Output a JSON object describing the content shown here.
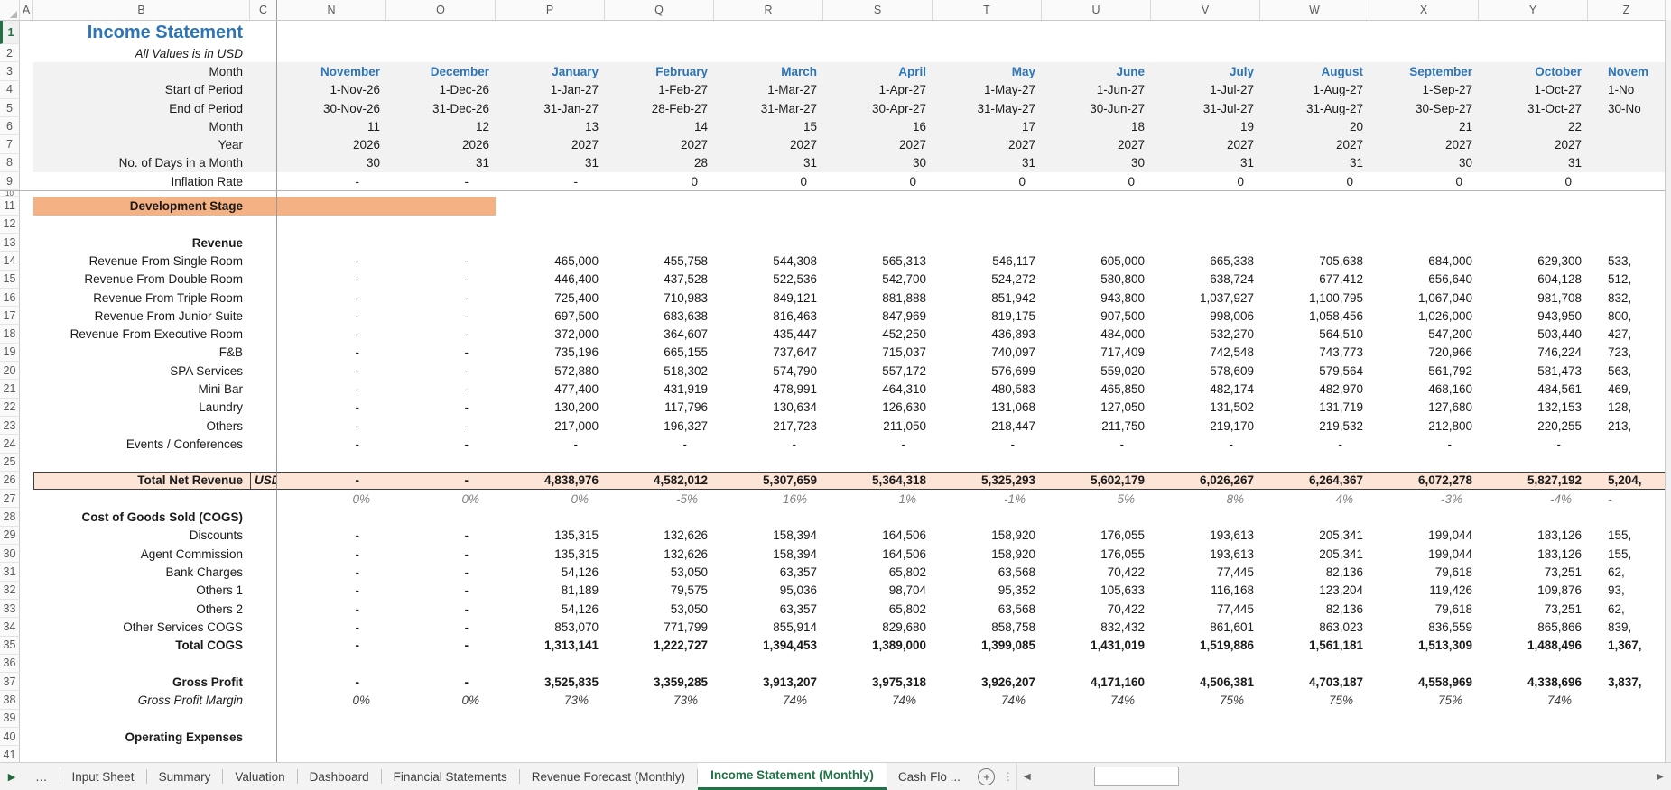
{
  "sheet": {
    "title": "Income Statement",
    "subtitle": "All Values is in USD",
    "columns": [
      "A",
      "B",
      "C",
      "N",
      "O",
      "P",
      "Q",
      "R",
      "S",
      "T",
      "U",
      "V",
      "W",
      "X",
      "Y",
      "Z"
    ],
    "rows": [
      {
        "n": 1,
        "type": "title",
        "label": "Income Statement"
      },
      {
        "n": 2,
        "type": "subtitle",
        "label": "All Values is in USD"
      },
      {
        "n": 3,
        "type": "months",
        "label": "Month",
        "v": [
          "November",
          "December",
          "January",
          "February",
          "March",
          "April",
          "May",
          "June",
          "July",
          "August",
          "September",
          "October",
          "Novem"
        ]
      },
      {
        "n": 4,
        "type": "shaded",
        "label": "Start of Period",
        "v": [
          "1-Nov-26",
          "1-Dec-26",
          "1-Jan-27",
          "1-Feb-27",
          "1-Mar-27",
          "1-Apr-27",
          "1-May-27",
          "1-Jun-27",
          "1-Jul-27",
          "1-Aug-27",
          "1-Sep-27",
          "1-Oct-27",
          "1-No"
        ]
      },
      {
        "n": 5,
        "type": "shaded",
        "label": "End of Period",
        "v": [
          "30-Nov-26",
          "31-Dec-26",
          "31-Jan-27",
          "28-Feb-27",
          "31-Mar-27",
          "30-Apr-27",
          "31-May-27",
          "30-Jun-27",
          "31-Jul-27",
          "31-Aug-27",
          "30-Sep-27",
          "31-Oct-27",
          "30-No"
        ]
      },
      {
        "n": 6,
        "type": "shaded",
        "label": "Month",
        "v": [
          "11",
          "12",
          "13",
          "14",
          "15",
          "16",
          "17",
          "18",
          "19",
          "20",
          "21",
          "22",
          ""
        ]
      },
      {
        "n": 7,
        "type": "shaded",
        "label": "Year",
        "v": [
          "2026",
          "2026",
          "2027",
          "2027",
          "2027",
          "2027",
          "2027",
          "2027",
          "2027",
          "2027",
          "2027",
          "2027",
          ""
        ]
      },
      {
        "n": 8,
        "type": "shaded",
        "label": "No. of Days in a Month",
        "v": [
          "30",
          "31",
          "31",
          "28",
          "31",
          "30",
          "31",
          "30",
          "31",
          "31",
          "30",
          "31",
          ""
        ]
      },
      {
        "n": 9,
        "type": "plain",
        "label": "Inflation Rate",
        "v": [
          "-",
          "-",
          "-",
          "0",
          "0",
          "0",
          "0",
          "0",
          "0",
          "0",
          "0",
          "0",
          ""
        ]
      },
      {
        "n": 10,
        "type": "collapsed"
      },
      {
        "n": 11,
        "type": "devstage",
        "label": "Development Stage"
      },
      {
        "n": 12,
        "type": "blank"
      },
      {
        "n": 13,
        "type": "section",
        "label": "Revenue"
      },
      {
        "n": 14,
        "type": "data",
        "label": "Revenue From Single Room",
        "v": [
          "-",
          "-",
          "465,000",
          "455,758",
          "544,308",
          "565,313",
          "546,117",
          "605,000",
          "665,338",
          "705,638",
          "684,000",
          "629,300",
          "533,"
        ]
      },
      {
        "n": 15,
        "type": "data",
        "label": "Revenue From Double Room",
        "v": [
          "-",
          "-",
          "446,400",
          "437,528",
          "522,536",
          "542,700",
          "524,272",
          "580,800",
          "638,724",
          "677,412",
          "656,640",
          "604,128",
          "512,"
        ]
      },
      {
        "n": 16,
        "type": "data",
        "label": "Revenue From Triple Room",
        "v": [
          "-",
          "-",
          "725,400",
          "710,983",
          "849,121",
          "881,888",
          "851,942",
          "943,800",
          "1,037,927",
          "1,100,795",
          "1,067,040",
          "981,708",
          "832,"
        ]
      },
      {
        "n": 17,
        "type": "data",
        "label": "Revenue From Junior Suite",
        "v": [
          "-",
          "-",
          "697,500",
          "683,638",
          "816,463",
          "847,969",
          "819,175",
          "907,500",
          "998,006",
          "1,058,456",
          "1,026,000",
          "943,950",
          "800,"
        ]
      },
      {
        "n": 18,
        "type": "data",
        "label": "Revenue From Executive Room",
        "v": [
          "-",
          "-",
          "372,000",
          "364,607",
          "435,447",
          "452,250",
          "436,893",
          "484,000",
          "532,270",
          "564,510",
          "547,200",
          "503,440",
          "427,"
        ]
      },
      {
        "n": 19,
        "type": "data",
        "label": "F&B",
        "v": [
          "-",
          "-",
          "735,196",
          "665,155",
          "737,647",
          "715,037",
          "740,097",
          "717,409",
          "742,548",
          "743,773",
          "720,966",
          "746,224",
          "723,"
        ]
      },
      {
        "n": 20,
        "type": "data",
        "label": "SPA Services",
        "v": [
          "-",
          "-",
          "572,880",
          "518,302",
          "574,790",
          "557,172",
          "576,699",
          "559,020",
          "578,609",
          "579,564",
          "561,792",
          "581,473",
          "563,"
        ]
      },
      {
        "n": 21,
        "type": "data",
        "label": "Mini Bar",
        "v": [
          "-",
          "-",
          "477,400",
          "431,919",
          "478,991",
          "464,310",
          "480,583",
          "465,850",
          "482,174",
          "482,970",
          "468,160",
          "484,561",
          "469,"
        ]
      },
      {
        "n": 22,
        "type": "data",
        "label": "Laundry",
        "v": [
          "-",
          "-",
          "130,200",
          "117,796",
          "130,634",
          "126,630",
          "131,068",
          "127,050",
          "131,502",
          "131,719",
          "127,680",
          "132,153",
          "128,"
        ]
      },
      {
        "n": 23,
        "type": "data",
        "label": "Others",
        "v": [
          "-",
          "-",
          "217,000",
          "196,327",
          "217,723",
          "211,050",
          "218,447",
          "211,750",
          "219,170",
          "219,532",
          "212,800",
          "220,255",
          "213,"
        ]
      },
      {
        "n": 24,
        "type": "data",
        "label": "Events / Conferences",
        "v": [
          "-",
          "-",
          "-",
          "-",
          "-",
          "-",
          "-",
          "-",
          "-",
          "-",
          "-",
          "-",
          ""
        ]
      },
      {
        "n": 25,
        "type": "blank"
      },
      {
        "n": 26,
        "type": "total",
        "label": "Total Net Revenue",
        "c": "USD",
        "v": [
          "-",
          "-",
          "4,838,976",
          "4,582,012",
          "5,307,659",
          "5,364,318",
          "5,325,293",
          "5,602,179",
          "6,026,267",
          "6,264,367",
          "6,072,278",
          "5,827,192",
          "5,204,"
        ]
      },
      {
        "n": 27,
        "type": "pct",
        "label": "",
        "v": [
          "0%",
          "0%",
          "0%",
          "-5%",
          "16%",
          "1%",
          "-1%",
          "5%",
          "8%",
          "4%",
          "-3%",
          "-4%",
          "-"
        ]
      },
      {
        "n": 28,
        "type": "section",
        "label": "Cost of Goods Sold (COGS)"
      },
      {
        "n": 29,
        "type": "data",
        "label": "Discounts",
        "v": [
          "-",
          "-",
          "135,315",
          "132,626",
          "158,394",
          "164,506",
          "158,920",
          "176,055",
          "193,613",
          "205,341",
          "199,044",
          "183,126",
          "155,"
        ]
      },
      {
        "n": 30,
        "type": "data",
        "label": "Agent Commission",
        "v": [
          "-",
          "-",
          "135,315",
          "132,626",
          "158,394",
          "164,506",
          "158,920",
          "176,055",
          "193,613",
          "205,341",
          "199,044",
          "183,126",
          "155,"
        ]
      },
      {
        "n": 31,
        "type": "data",
        "label": "Bank Charges",
        "v": [
          "-",
          "-",
          "54,126",
          "53,050",
          "63,357",
          "65,802",
          "63,568",
          "70,422",
          "77,445",
          "82,136",
          "79,618",
          "73,251",
          "62,"
        ]
      },
      {
        "n": 32,
        "type": "data",
        "label": "Others 1",
        "v": [
          "-",
          "-",
          "81,189",
          "79,575",
          "95,036",
          "98,704",
          "95,352",
          "105,633",
          "116,168",
          "123,204",
          "119,426",
          "109,876",
          "93,"
        ]
      },
      {
        "n": 33,
        "type": "data",
        "label": "Others 2",
        "v": [
          "-",
          "-",
          "54,126",
          "53,050",
          "63,357",
          "65,802",
          "63,568",
          "70,422",
          "77,445",
          "82,136",
          "79,618",
          "73,251",
          "62,"
        ]
      },
      {
        "n": 34,
        "type": "data",
        "label": "Other Services COGS",
        "v": [
          "-",
          "-",
          "853,070",
          "771,799",
          "855,914",
          "829,680",
          "858,758",
          "832,432",
          "861,601",
          "863,023",
          "836,559",
          "865,866",
          "839,"
        ]
      },
      {
        "n": 35,
        "type": "bolddata",
        "label": "Total COGS",
        "v": [
          "-",
          "-",
          "1,313,141",
          "1,222,727",
          "1,394,453",
          "1,389,000",
          "1,399,085",
          "1,431,019",
          "1,519,886",
          "1,561,181",
          "1,513,309",
          "1,488,496",
          "1,367,"
        ]
      },
      {
        "n": 36,
        "type": "blank"
      },
      {
        "n": 37,
        "type": "bolddata",
        "label": "Gross Profit",
        "v": [
          "-",
          "-",
          "3,525,835",
          "3,359,285",
          "3,913,207",
          "3,975,318",
          "3,926,207",
          "4,171,160",
          "4,506,381",
          "4,703,187",
          "4,558,969",
          "4,338,696",
          "3,837,"
        ]
      },
      {
        "n": 38,
        "type": "pctlabeled",
        "label": "Gross Profit Margin",
        "v": [
          "0%",
          "0%",
          "73%",
          "73%",
          "74%",
          "74%",
          "74%",
          "74%",
          "75%",
          "75%",
          "75%",
          "74%",
          ""
        ]
      },
      {
        "n": 39,
        "type": "blank"
      },
      {
        "n": 40,
        "type": "section",
        "label": "Operating Expenses"
      },
      {
        "n": 41,
        "type": "blank"
      }
    ]
  },
  "tabbar": {
    "nav_forward": "▶",
    "overflow_tab": "…",
    "tabs": [
      "Input Sheet",
      "Summary",
      "Valuation",
      "Dashboard",
      "Financial Statements",
      "Revenue Forecast (Monthly)"
    ],
    "active_tab": "Income Statement (Monthly)",
    "partial_tab": "Cash Flo ...",
    "add_sheet": "+",
    "dots": "⋮",
    "scroll_left": "◀",
    "scroll_right": "▶"
  },
  "colors": {
    "title_blue": "#2E75B6",
    "month_blue": "#2E75B6",
    "shade_gray": "#F2F2F2",
    "devstage_orange": "#F4B183",
    "total_band_peach": "#FCE4D6",
    "active_tab_green": "#217346",
    "pct_gray": "#808080"
  }
}
